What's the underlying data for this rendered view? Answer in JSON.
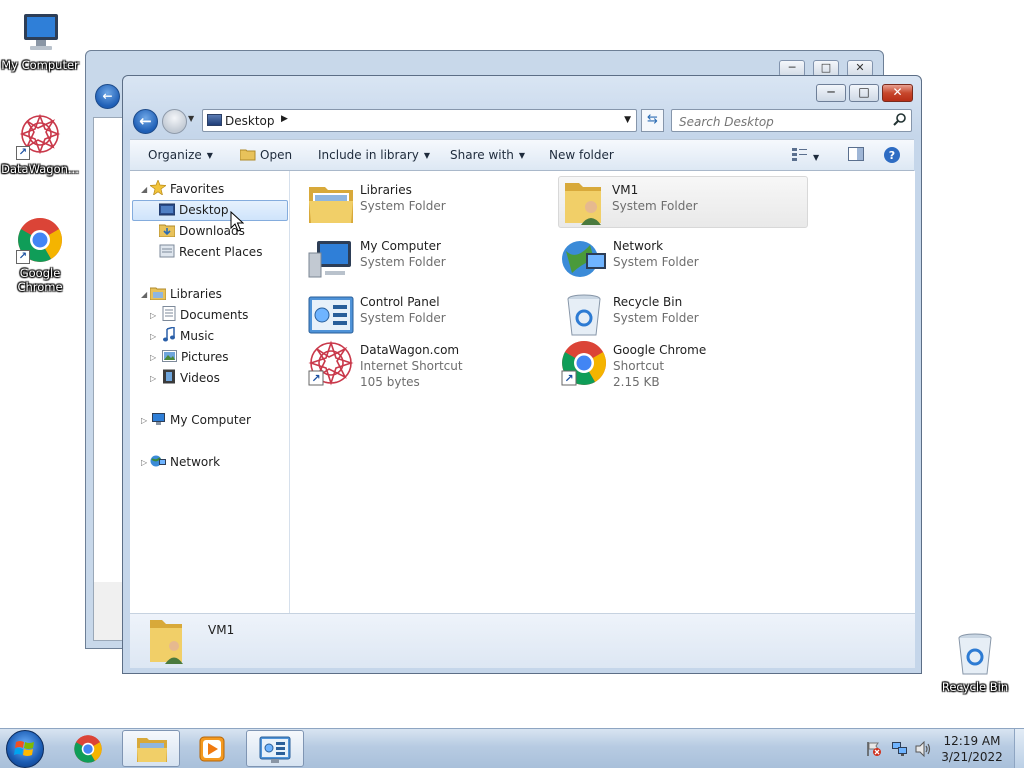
{
  "desktop": {
    "icons": [
      {
        "label": "My Computer"
      },
      {
        "label": "DataWagon..."
      },
      {
        "label": "Google Chrome"
      },
      {
        "label": "Recycle Bin"
      }
    ]
  },
  "window": {
    "address": "Desktop",
    "search_placeholder": "Search Desktop",
    "controls": {
      "minimize": "─",
      "maximize": "□",
      "close": "✕"
    },
    "toolbar": {
      "organize": "Organize",
      "open": "Open",
      "include_in_library": "Include in library",
      "share_with": "Share with",
      "new_folder": "New folder"
    },
    "nav": {
      "favorites": "Favorites",
      "desktop": "Desktop",
      "downloads": "Downloads",
      "recent_places": "Recent Places",
      "libraries": "Libraries",
      "documents": "Documents",
      "music": "Music",
      "pictures": "Pictures",
      "videos": "Videos",
      "my_computer": "My Computer",
      "network": "Network"
    },
    "items": [
      {
        "name": "Libraries",
        "type": "System Folder",
        "size": ""
      },
      {
        "name": "VM1",
        "type": "System Folder",
        "size": ""
      },
      {
        "name": "My Computer",
        "type": "System Folder",
        "size": ""
      },
      {
        "name": "Network",
        "type": "System Folder",
        "size": ""
      },
      {
        "name": "Control Panel",
        "type": "System Folder",
        "size": ""
      },
      {
        "name": "Recycle Bin",
        "type": "System Folder",
        "size": ""
      },
      {
        "name": "DataWagon.com",
        "type": "Internet Shortcut",
        "size": "105 bytes"
      },
      {
        "name": "Google Chrome",
        "type": "Shortcut",
        "size": "2.15 KB"
      }
    ],
    "details": {
      "name": "VM1"
    }
  },
  "taskbar": {
    "time": "12:19 AM",
    "date": "3/21/2022"
  },
  "colors": {
    "selection": "#cfe4fb",
    "selection_border": "#84acdd",
    "taskbar": "#b7cbe2",
    "close_button": "#c7472c"
  },
  "icons": [
    "monitor-icon",
    "datawagon-icon",
    "chrome-icon",
    "recycle-bin-icon",
    "folder-icon",
    "user-folder-icon",
    "network-icon",
    "control-panel-icon",
    "star-icon",
    "library-icon",
    "document-icon",
    "music-icon",
    "pictures-icon",
    "videos-icon",
    "search-icon",
    "refresh-icon",
    "help-icon",
    "view-icon",
    "pane-icon",
    "start-orb-icon",
    "media-player-icon",
    "explorer-icon"
  ]
}
